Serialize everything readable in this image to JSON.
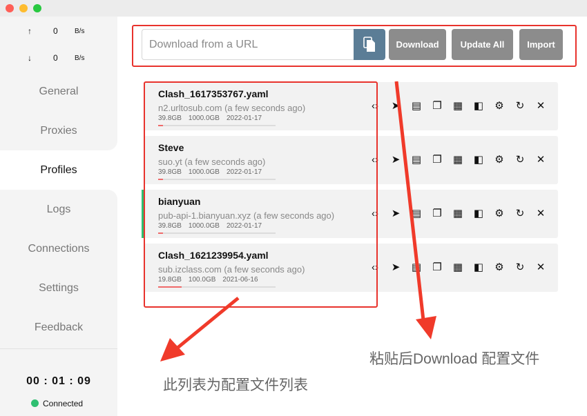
{
  "window": {
    "title": ""
  },
  "traffic": {
    "up": {
      "arrow": "↑",
      "value": "0",
      "unit": "B/s"
    },
    "down": {
      "arrow": "↓",
      "value": "0",
      "unit": "B/s"
    }
  },
  "nav": {
    "items": [
      {
        "label": "General",
        "active": false
      },
      {
        "label": "Proxies",
        "active": false
      },
      {
        "label": "Profiles",
        "active": true
      },
      {
        "label": "Logs",
        "active": false
      },
      {
        "label": "Connections",
        "active": false
      },
      {
        "label": "Settings",
        "active": false
      },
      {
        "label": "Feedback",
        "active": false
      }
    ]
  },
  "footer": {
    "clock": "00 : 01 : 09",
    "status": "Connected",
    "status_color": "#2fbf71"
  },
  "toolbar": {
    "url_placeholder": "Download from a URL",
    "download_label": "Download",
    "update_all_label": "Update All",
    "import_label": "Import"
  },
  "profiles": [
    {
      "name": "Clash_1617353767.yaml",
      "host": "n2.urltosub.com (a few seconds ago)",
      "used": "39.8GB",
      "total": "1000.0GB",
      "expire": "2022-01-17",
      "usage_fraction": 0.04,
      "selected": false
    },
    {
      "name": "Steve",
      "host": "suo.yt (a few seconds ago)",
      "used": "39.8GB",
      "total": "1000.0GB",
      "expire": "2022-01-17",
      "usage_fraction": 0.04,
      "selected": false
    },
    {
      "name": "bianyuan",
      "host": "pub-api-1.bianyuan.xyz (a few seconds ago)",
      "used": "39.8GB",
      "total": "1000.0GB",
      "expire": "2022-01-17",
      "usage_fraction": 0.04,
      "selected": true
    },
    {
      "name": "Clash_1621239954.yaml",
      "host": "sub.izclass.com (a few seconds ago)",
      "used": "19.8GB",
      "total": "100.0GB",
      "expire": "2021-06-16",
      "usage_fraction": 0.198,
      "selected": false
    }
  ],
  "profile_actions": [
    "code-icon",
    "send-icon",
    "list-icon",
    "copy-icon",
    "qrcode-icon",
    "compare-icon",
    "gear-icon",
    "refresh-icon",
    "close-icon"
  ],
  "annotations": {
    "download_caption": "粘贴后Download 配置文件",
    "list_caption": "此列表为配置文件列表",
    "color": "#e8322c"
  }
}
